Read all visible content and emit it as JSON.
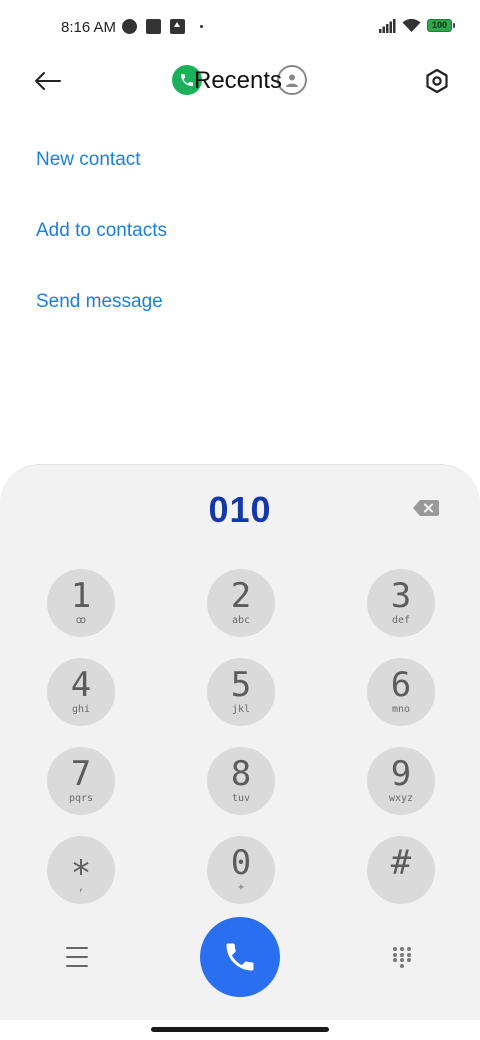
{
  "status_bar": {
    "time": "8:16 AM",
    "battery": "100",
    "icons": [
      "notification-round-icon",
      "notification-square-icon",
      "upload-icon",
      "dot-icon",
      "signal-icon",
      "wifi-icon",
      "battery-icon"
    ]
  },
  "header": {
    "title": "Recents",
    "back_icon": "arrow-left-icon",
    "phone_tab_icon": "phone-icon",
    "contacts_tab_icon": "person-icon",
    "settings_icon": "hexagon-settings-icon"
  },
  "options": {
    "new_contact": "New contact",
    "add_to_contacts": "Add to contacts",
    "send_message": "Send message"
  },
  "dialpad": {
    "number": "010",
    "keys": [
      {
        "digit": "1",
        "letters": "ꝏ"
      },
      {
        "digit": "2",
        "letters": "abc"
      },
      {
        "digit": "3",
        "letters": "def"
      },
      {
        "digit": "4",
        "letters": "ghi"
      },
      {
        "digit": "5",
        "letters": "jkl"
      },
      {
        "digit": "6",
        "letters": "mno"
      },
      {
        "digit": "7",
        "letters": "pqrs"
      },
      {
        "digit": "8",
        "letters": "tuv"
      },
      {
        "digit": "9",
        "letters": "wxyz"
      },
      {
        "digit": "⁎",
        "letters": ","
      },
      {
        "digit": "0",
        "letters": "+"
      },
      {
        "digit": "#",
        "letters": ""
      }
    ]
  },
  "colors": {
    "accent_link": "#1a80e0",
    "number": "#1438a8",
    "call_button": "#2a6ff0",
    "phone_tab": "#1ab15a",
    "key_bg": "#dadada",
    "panel_bg": "#f2f2f2"
  }
}
